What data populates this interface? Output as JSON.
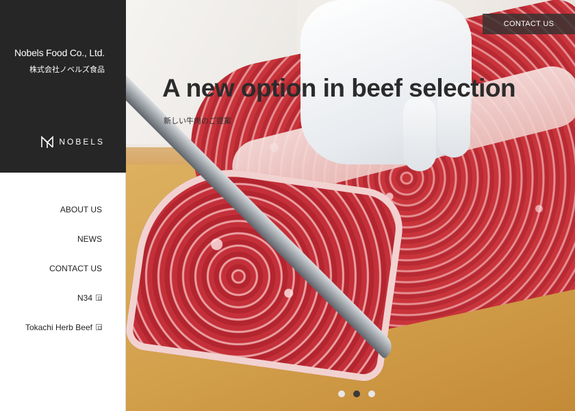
{
  "company": {
    "name_en": "Nobels Food Co., Ltd.",
    "name_jp": "株式会社ノベルズ食品",
    "logo_text": "NOBELS"
  },
  "nav": {
    "items": [
      {
        "label": "ABOUT US",
        "external": false
      },
      {
        "label": "NEWS",
        "external": false
      },
      {
        "label": "CONTACT US",
        "external": false
      },
      {
        "label": "N34",
        "external": true
      },
      {
        "label": "Tokachi Herb Beef",
        "external": true
      }
    ]
  },
  "hero": {
    "title": "A new option in beef selection",
    "subtitle": "新しい牛肉のご提案",
    "contact_button": "CONTACT US",
    "slides": 3,
    "active_slide": 2
  },
  "colors": {
    "brand_dark": "#262626",
    "button_bg": "#373230"
  }
}
